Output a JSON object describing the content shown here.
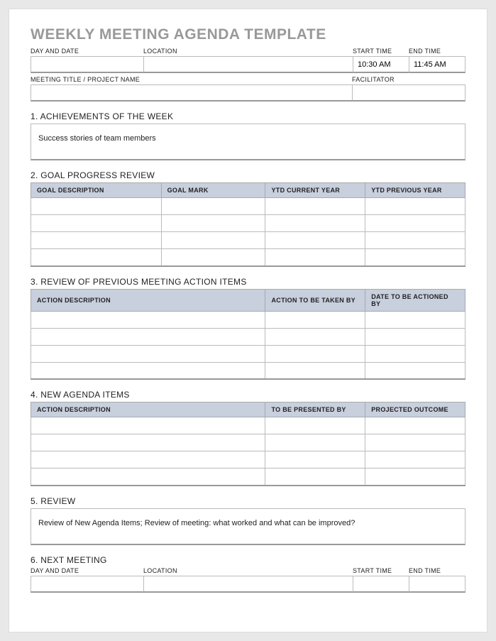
{
  "title": "WEEKLY MEETING AGENDA TEMPLATE",
  "header_row1": {
    "day_date": {
      "label": "DAY AND DATE",
      "value": ""
    },
    "location": {
      "label": "LOCATION",
      "value": ""
    },
    "start_time": {
      "label": "START TIME",
      "value": "10:30 AM"
    },
    "end_time": {
      "label": "END TIME",
      "value": "11:45 AM"
    }
  },
  "header_row2": {
    "meeting_title": {
      "label": "MEETING TITLE / PROJECT NAME",
      "value": ""
    },
    "facilitator": {
      "label": "FACILITATOR",
      "value": ""
    }
  },
  "sections": {
    "achievements": {
      "heading": "1. ACHIEVEMENTS OF THE WEEK",
      "content": "Success stories of team members"
    },
    "goal_progress": {
      "heading": "2. GOAL PROGRESS REVIEW",
      "columns": [
        "GOAL DESCRIPTION",
        "GOAL MARK",
        "YTD CURRENT YEAR",
        "YTD PREVIOUS YEAR"
      ],
      "rows": [
        [
          "",
          "",
          "",
          ""
        ],
        [
          "",
          "",
          "",
          ""
        ],
        [
          "",
          "",
          "",
          ""
        ],
        [
          "",
          "",
          "",
          ""
        ]
      ]
    },
    "previous_actions": {
      "heading": "3. REVIEW OF PREVIOUS MEETING ACTION ITEMS",
      "columns": [
        "ACTION DESCRIPTION",
        "ACTION TO BE TAKEN BY",
        "DATE TO BE ACTIONED BY"
      ],
      "rows": [
        [
          "",
          "",
          ""
        ],
        [
          "",
          "",
          ""
        ],
        [
          "",
          "",
          ""
        ],
        [
          "",
          "",
          ""
        ]
      ]
    },
    "new_agenda": {
      "heading": "4. NEW AGENDA ITEMS",
      "columns": [
        "ACTION DESCRIPTION",
        "TO BE PRESENTED BY",
        "PROJECTED OUTCOME"
      ],
      "rows": [
        [
          "",
          "",
          ""
        ],
        [
          "",
          "",
          ""
        ],
        [
          "",
          "",
          ""
        ],
        [
          "",
          "",
          ""
        ]
      ]
    },
    "review": {
      "heading": "5. REVIEW",
      "content": "Review of New Agenda Items; Review of meeting: what worked and what can be improved?"
    },
    "next_meeting": {
      "heading": "6. NEXT MEETING",
      "day_date": {
        "label": "DAY AND DATE",
        "value": ""
      },
      "location": {
        "label": "LOCATION",
        "value": ""
      },
      "start_time": {
        "label": "START TIME",
        "value": ""
      },
      "end_time": {
        "label": "END TIME",
        "value": ""
      }
    }
  }
}
